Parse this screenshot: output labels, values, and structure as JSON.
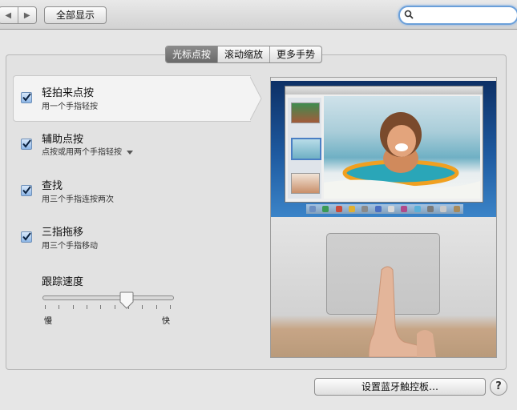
{
  "toolbar": {
    "back_glyph": "◀",
    "forward_glyph": "▶",
    "show_all_label": "全部显示",
    "search_placeholder": ""
  },
  "tabs": [
    {
      "label": "光标点按",
      "selected": true
    },
    {
      "label": "滚动缩放",
      "selected": false
    },
    {
      "label": "更多手势",
      "selected": false
    }
  ],
  "options": [
    {
      "title": "轻拍来点按",
      "subtitle": "用一个手指轻按",
      "checked": true,
      "has_dropdown": false
    },
    {
      "title": "辅助点按",
      "subtitle": "点按或用两个手指轻按",
      "checked": true,
      "has_dropdown": true
    },
    {
      "title": "查找",
      "subtitle": "用三个手指连按两次",
      "checked": true,
      "has_dropdown": false
    },
    {
      "title": "三指拖移",
      "subtitle": "用三个手指移动",
      "checked": true,
      "has_dropdown": false
    }
  ],
  "tracking": {
    "label": "跟踪速度",
    "min_label": "慢",
    "max_label": "快",
    "value_fraction": 0.65,
    "tick_count": 10
  },
  "footer": {
    "bluetooth_button": "设置蓝牙触控板…",
    "help_glyph": "?"
  },
  "colors": {
    "accent": "#6a9fd9",
    "checkbox": "#8db6e6",
    "selected_tab": "#6a6a6a"
  }
}
